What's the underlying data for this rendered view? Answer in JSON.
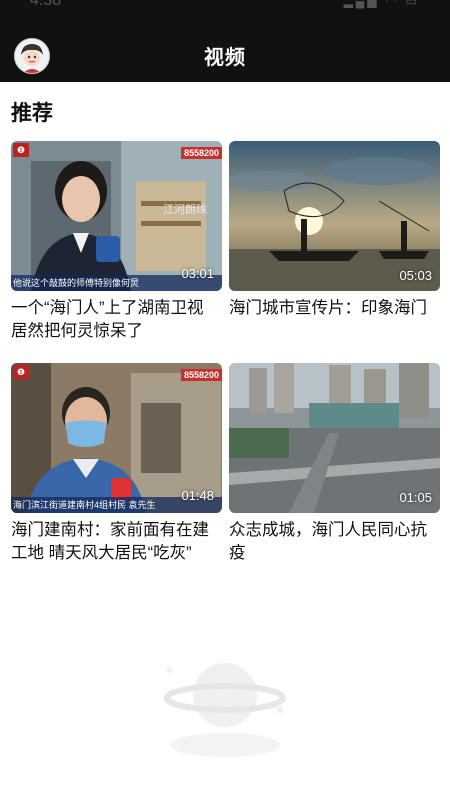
{
  "status_bar": {
    "time": "4:38"
  },
  "header": {
    "title": "视频",
    "avatar_icon": "user-avatar-icon"
  },
  "section": {
    "title": "推荐"
  },
  "videos": [
    {
      "title": "一个“海门人”上了湖南卫视 居然把何灵惊呆了",
      "duration": "03:01",
      "badge": "8558200",
      "caption": "他说这个敲鼓的师傅特别像何炅"
    },
    {
      "title": "海门城市宣传片：印象海门",
      "duration": "05:03"
    },
    {
      "title": "海门建南村：家前面有在建工地 晴天风大居民“吃灰”",
      "duration": "01:48",
      "badge": "8558200",
      "caption": "海门滨江街道建南村4组村民    袁先生"
    },
    {
      "title": "众志成城，海门人民同心抗疫",
      "duration": "01:05"
    }
  ],
  "colors": {
    "header_bg": "#111111",
    "accent_red": "#c9302c"
  }
}
